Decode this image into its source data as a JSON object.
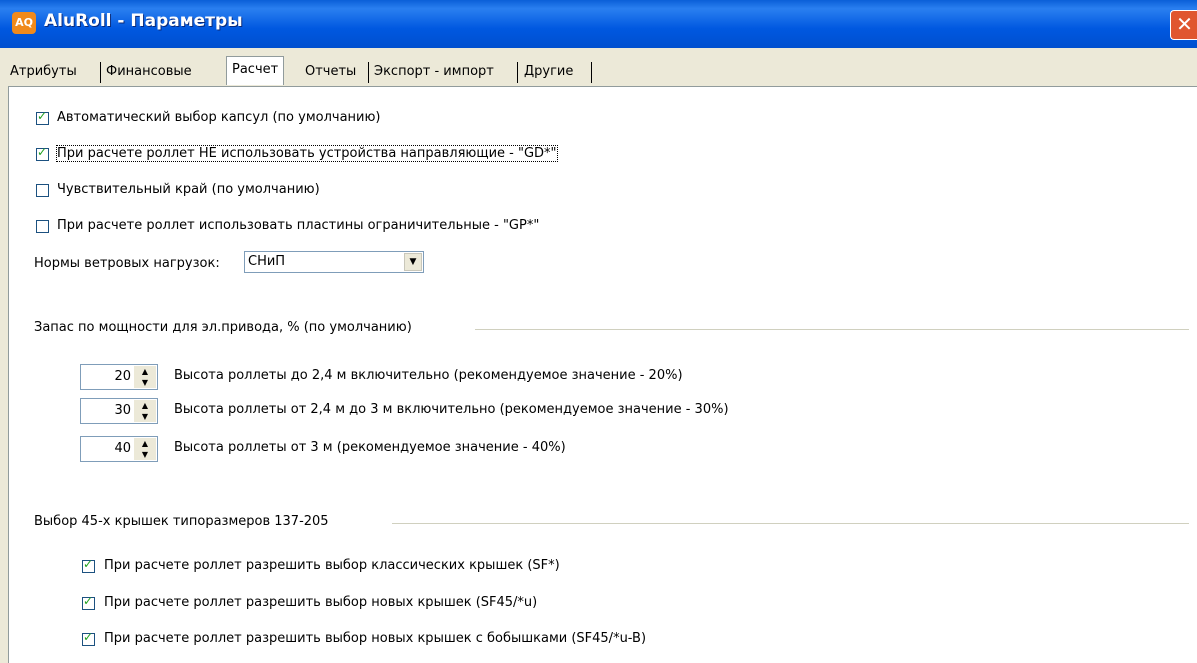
{
  "window": {
    "title": "AluRoll - Параметры",
    "icon": "aluroll-app-icon",
    "icon_text": "AQ",
    "close_glyph": "✕"
  },
  "tabs": [
    {
      "label": "Атрибуты"
    },
    {
      "label": "Финансовые"
    },
    {
      "label": "Расчет",
      "active": true
    },
    {
      "label": "Отчеты"
    },
    {
      "label": "Экспорт - импорт"
    },
    {
      "label": "Другие"
    }
  ],
  "options": [
    {
      "label": "Автоматический выбор капсул (по умолчанию)",
      "checked": true
    },
    {
      "label": "При расчете роллет НЕ использовать устройства направляющие - \"GD*\"",
      "checked": true
    },
    {
      "label": "Чувствительный край (по умолчанию)",
      "checked": false
    },
    {
      "label": "При расчете роллет использовать пластины ограничительные - \"GP*\"",
      "checked": false
    }
  ],
  "wind": {
    "label": "Нормы ветровых нагрузок:",
    "value": "СНиП"
  },
  "power": {
    "title": "Запас по мощности для эл.привода, % (по умолчанию)",
    "rows": [
      {
        "value": "20",
        "label": "Высота роллеты до 2,4 м включительно (рекомендуемое значение - 20%)"
      },
      {
        "value": "30",
        "label": "Высота роллеты от 2,4 м до 3 м включительно (рекомендуемое значение - 30%)"
      },
      {
        "value": "40",
        "label": "Высота роллеты от 3 м (рекомендуемое значение - 40%)"
      }
    ]
  },
  "lids": {
    "title": "Выбор 45-х крышек типоразмеров 137-205",
    "options": [
      {
        "label": "При расчете роллет разрешить выбор классических крышек (SF*)",
        "checked": true
      },
      {
        "label": "При расчете роллет разрешить выбор новых крышек (SF45/*u)",
        "checked": true
      },
      {
        "label": "При расчете роллет разрешить выбор новых крышек с бобышками (SF45/*u-B)",
        "checked": true
      }
    ]
  },
  "colors": {
    "title_bar": "#0058e0",
    "check_mark": "#21a121",
    "close_button": "#e0562f"
  }
}
